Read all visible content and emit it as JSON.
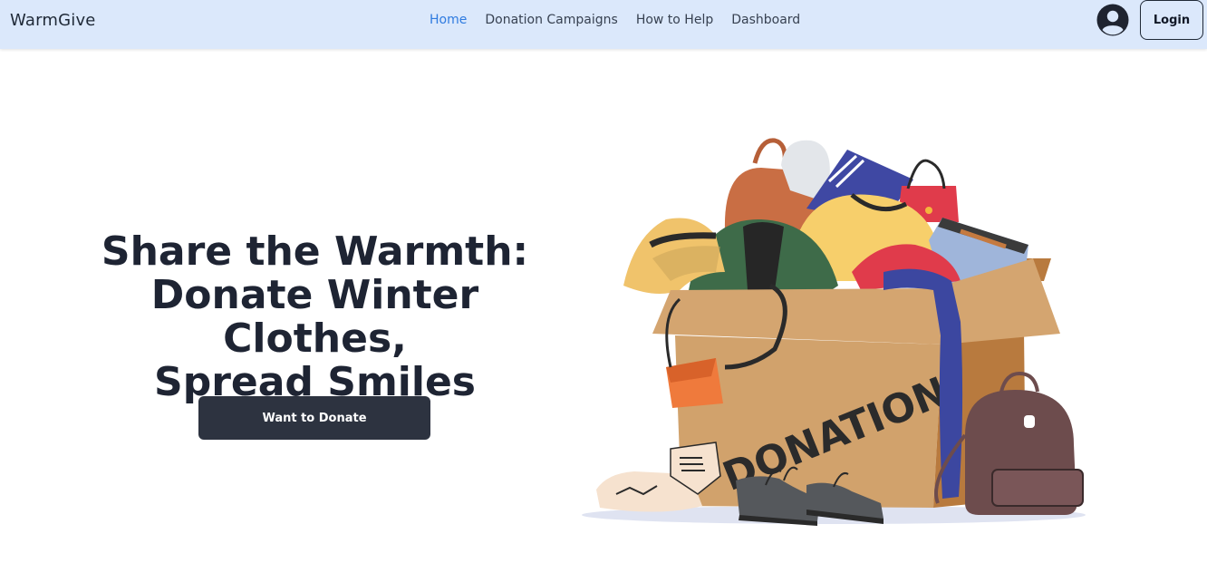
{
  "nav": {
    "brand": "WarmGive",
    "links": [
      "Home",
      "Donation Campaigns",
      "How to Help",
      "Dashboard"
    ],
    "active": "Home",
    "login_label": "Login"
  },
  "hero": {
    "title_lines": [
      "Share the Warmth:",
      "Donate Winter Clothes,",
      "Spread Smiles"
    ],
    "cta_label": "Want to Donate",
    "illustration_text": "DONATION"
  },
  "colors": {
    "nav_bg": "#dbe8fb",
    "active_link": "#2f7be0",
    "cta_bg": "#2d3340",
    "title": "#1e2433"
  }
}
